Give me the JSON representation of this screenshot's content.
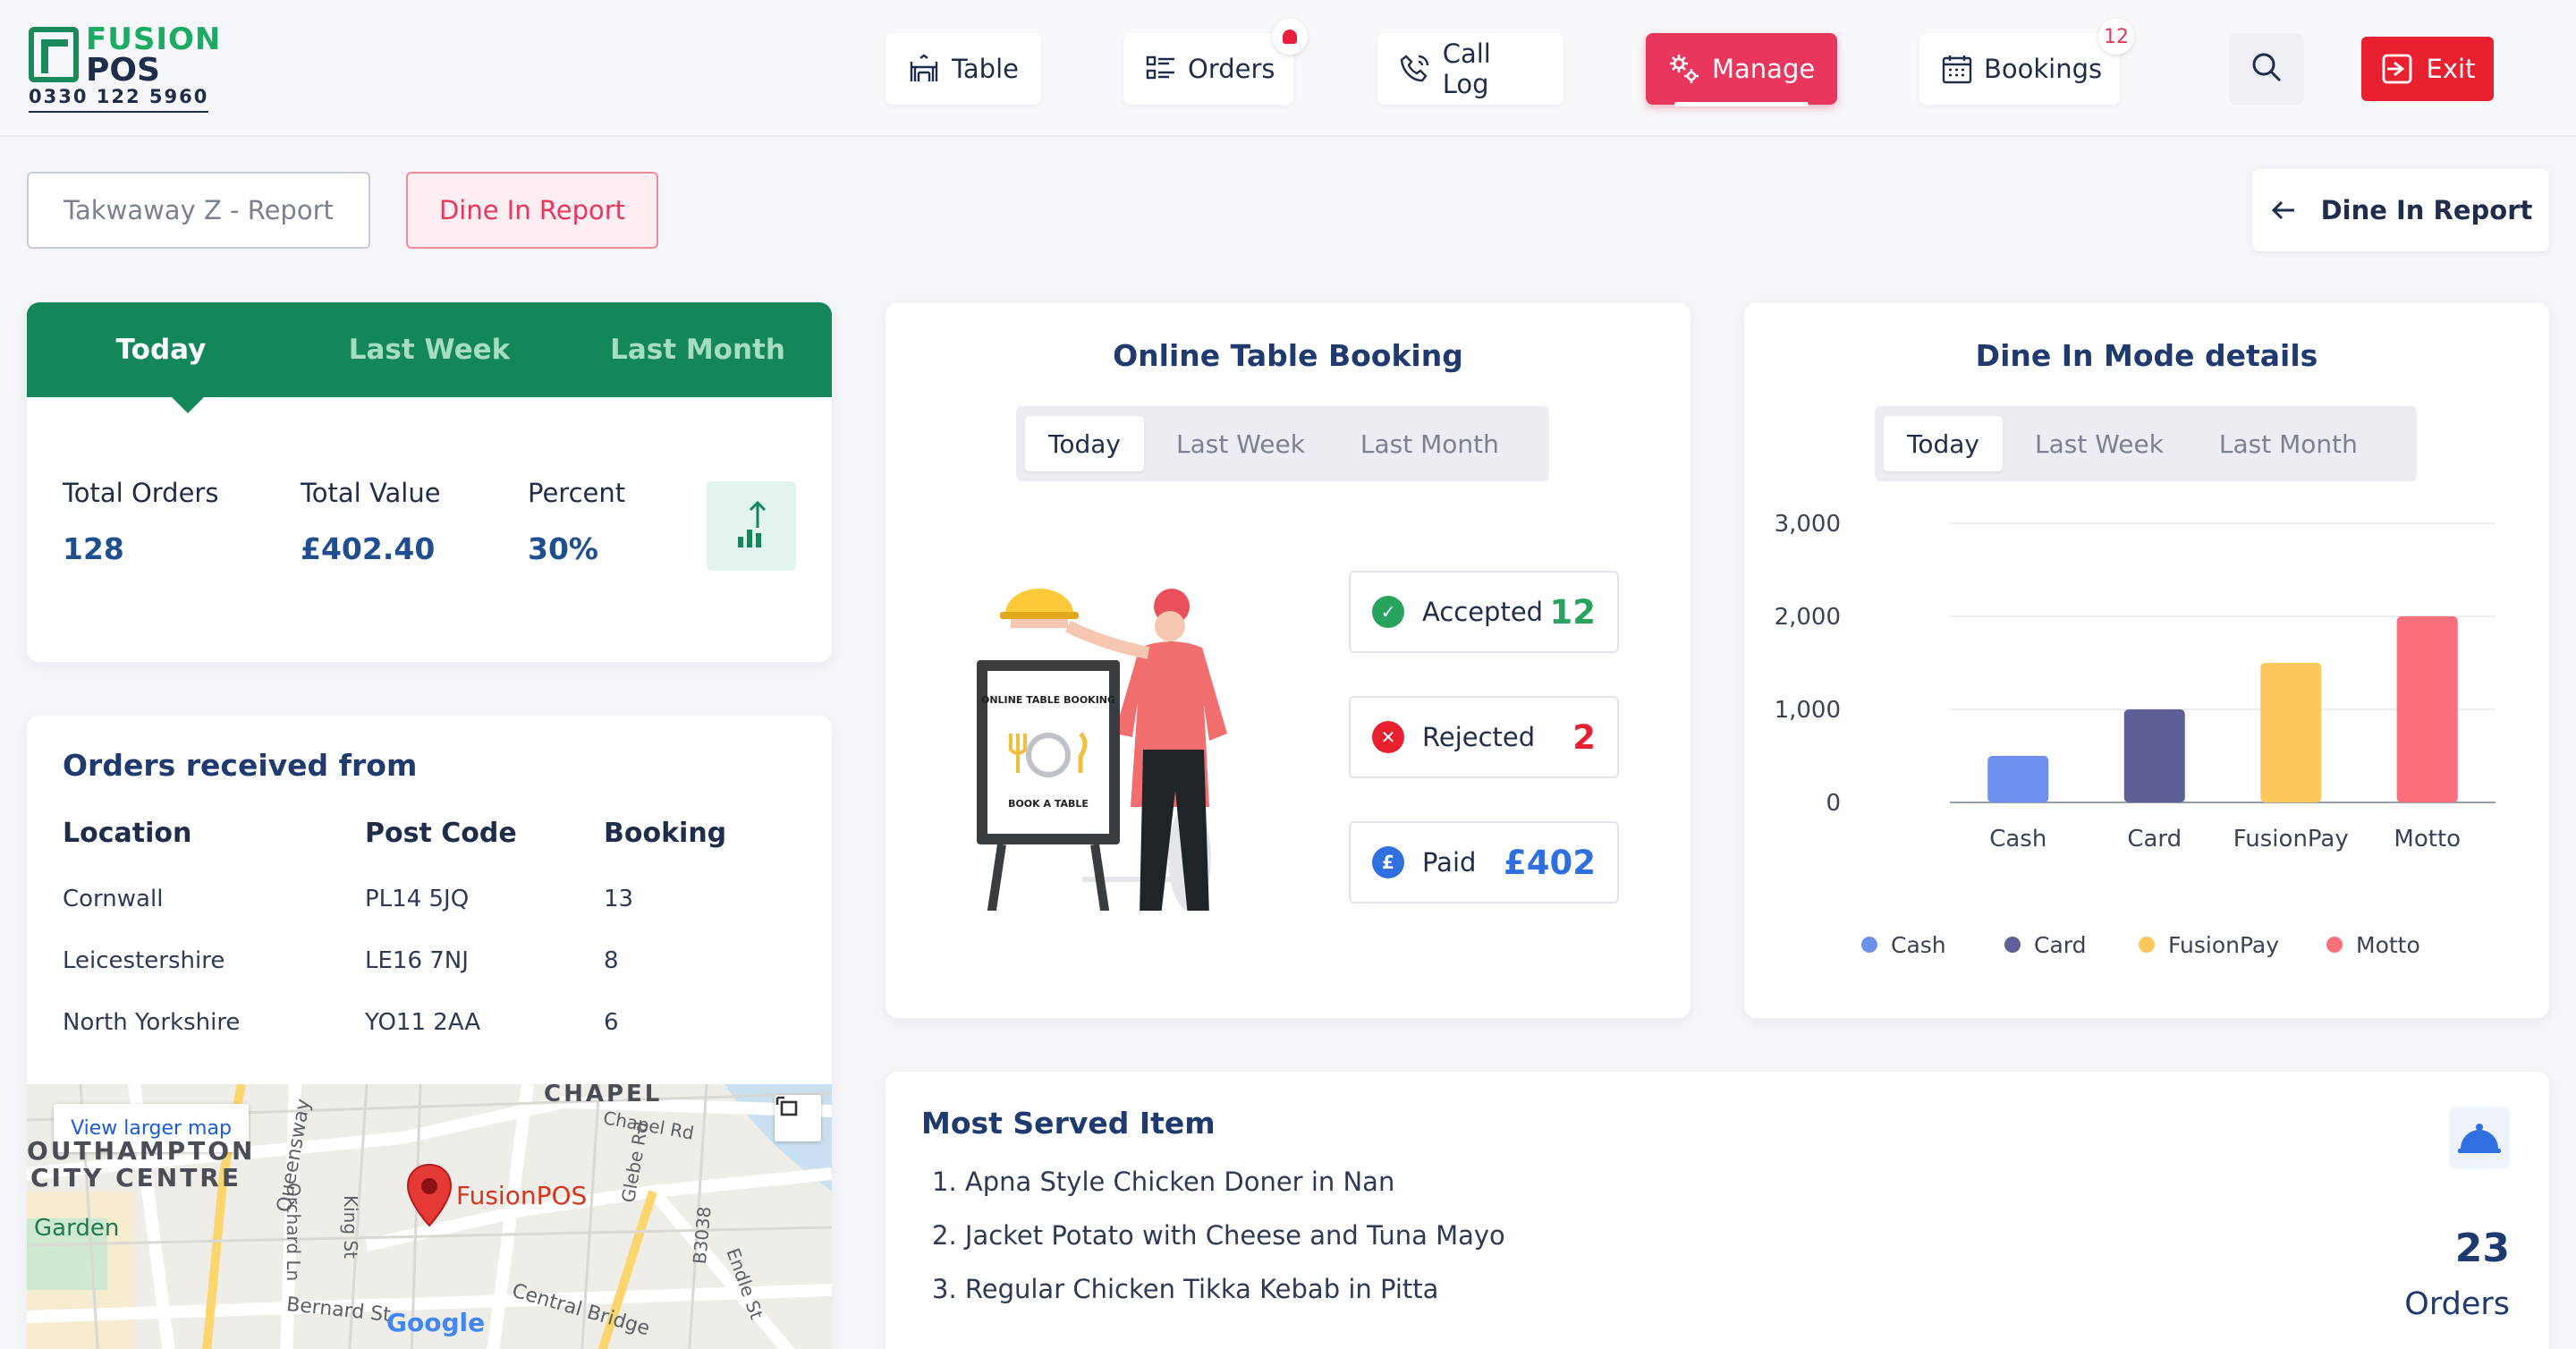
{
  "brand": {
    "name_top": "FUSION",
    "name_bottom": "POS",
    "phone": "0330 122 5960"
  },
  "nav": {
    "table": "Table",
    "orders": "Orders",
    "call_log": "Call Log",
    "manage": "Manage",
    "bookings": "Bookings",
    "bookings_badge": "12",
    "exit": "Exit"
  },
  "reports": {
    "takeaway": "Takwaway Z - Report",
    "dinein": "Dine In Report",
    "back": "Dine In Report"
  },
  "stats": {
    "tabs": [
      "Today",
      "Last Week",
      "Last Month"
    ],
    "total_orders_label": "Total Orders",
    "total_orders": "128",
    "total_value_label": "Total Value",
    "total_value": "£402.40",
    "percent_label": "Percent",
    "percent": "30%"
  },
  "orders_received": {
    "title": "Orders received from",
    "headers": [
      "Location",
      "Post Code",
      "Booking"
    ],
    "rows": [
      [
        "Cornwall",
        "PL14 5JQ",
        "13"
      ],
      [
        "Leicestershire",
        "LE16 7NJ",
        "8"
      ],
      [
        "North Yorkshire",
        "YO11 2AA",
        "6"
      ]
    ]
  },
  "map": {
    "view_larger": "View larger map",
    "pin_label": "FusionPOS",
    "city_line1": "OUTHAMPTON",
    "city_line2": "CITY CENTRE",
    "chapel": "CHAPEL",
    "garden": "Garden",
    "chapel_rd": "Chapel Rd",
    "orchard_ln": "Orchard Ln",
    "queensway": "Queensway",
    "king_st": "King St",
    "glebe_rd": "Glebe Rd",
    "b3038": "B3038",
    "endle_st": "Endle St",
    "bernard_st": "Bernard St",
    "central_bridge": "Central Bridge",
    "google": "Google"
  },
  "booking": {
    "title": "Online Table Booking",
    "tabs": [
      "Today",
      "Last Week",
      "Last Month"
    ],
    "board_title": "ONLINE TABLE BOOKING",
    "board_sub": "BOOK A TABLE",
    "accepted_label": "Accepted",
    "accepted": "12",
    "rejected_label": "Rejected",
    "rejected": "2",
    "paid_label": "Paid",
    "paid": "£402"
  },
  "dinein": {
    "title": "Dine In Mode details",
    "tabs": [
      "Today",
      "Last Week",
      "Last Month"
    ]
  },
  "chart_data": {
    "type": "bar",
    "categories": [
      "Cash",
      "Card",
      "FusionPay",
      "Motto"
    ],
    "values": [
      500,
      1000,
      1500,
      2000
    ],
    "colors": [
      "#6e8fec",
      "#5f5f97",
      "#fdc75e",
      "#fb6f7c"
    ],
    "yticks": [
      "0",
      "1,000",
      "2,000",
      "3,000"
    ],
    "ylim": [
      0,
      3000
    ],
    "legend": [
      "Cash",
      "Card",
      "FusionPay",
      "Motto"
    ],
    "legend_position": "bottom",
    "grid": true
  },
  "served": {
    "title": "Most Served Item",
    "items": [
      "1. Apna Style Chicken Doner in Nan",
      "2. Jacket Potato with Cheese and Tuna Mayo",
      "3. Regular Chicken Tikka Kebab in Pitta"
    ],
    "count": "23",
    "count_unit": "Orders"
  },
  "colors": {
    "brand_green": "#13865a",
    "accent_pink": "#e8365d",
    "exit_red": "#e8202f",
    "navy": "#1f3a6e"
  }
}
